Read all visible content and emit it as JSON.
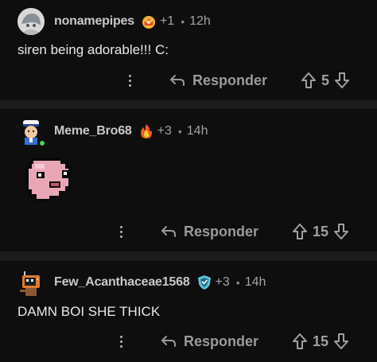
{
  "comments": [
    {
      "username": "nonamepipes",
      "award_count": "+1",
      "time": "12h",
      "text": "siren being adorable!!! C:",
      "reply_label": "Responder",
      "score": "5",
      "avatar_icon": "gray-character-avatar",
      "award_icon": "crown-award-icon"
    },
    {
      "username": "Meme_Bro68",
      "award_count": "+3",
      "time": "14h",
      "text": "",
      "image_icon": "pixel-pink-ghost-image",
      "reply_label": "Responder",
      "score": "15",
      "avatar_icon": "sailor-character-avatar",
      "award_icon": "fire-award-icon"
    },
    {
      "username": "Few_Acanthaceae1568",
      "award_count": "+3",
      "time": "14h",
      "text": "DAMN BOI SHE THICK",
      "reply_label": "Responder",
      "score": "15",
      "avatar_icon": "tv-head-character-avatar",
      "award_icon": "shield-award-icon"
    }
  ],
  "colors": {
    "background": "#0e0e0e",
    "separator": "#1c1c1c",
    "online": "#46d160"
  }
}
